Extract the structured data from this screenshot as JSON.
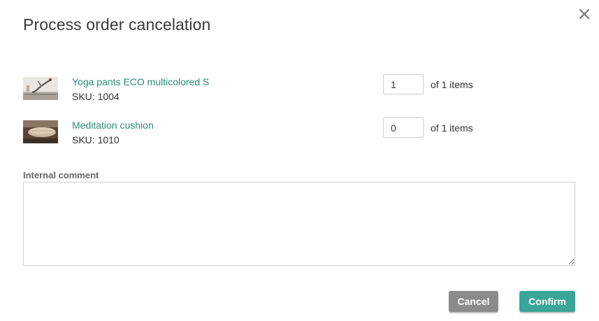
{
  "dialog": {
    "title": "Process order cancelation",
    "close_icon": "close-icon"
  },
  "items": [
    {
      "name": "Yoga pants ECO multicolored S",
      "sku": "SKU: 1004",
      "quantity": "1",
      "of_label": "of 1 items",
      "thumbnail_icon": "product-thumbnail-yoga"
    },
    {
      "name": "Meditation cushion",
      "sku": "SKU: 1010",
      "quantity": "0",
      "of_label": "of 1 items",
      "thumbnail_icon": "product-thumbnail-cushion"
    }
  ],
  "comment": {
    "label": "Internal comment",
    "value": ""
  },
  "actions": {
    "cancel_label": "Cancel",
    "confirm_label": "Confirm"
  },
  "colors": {
    "link": "#2a8c78",
    "cancel_bg": "#8b8b8b",
    "confirm_bg": "#3aa698"
  }
}
